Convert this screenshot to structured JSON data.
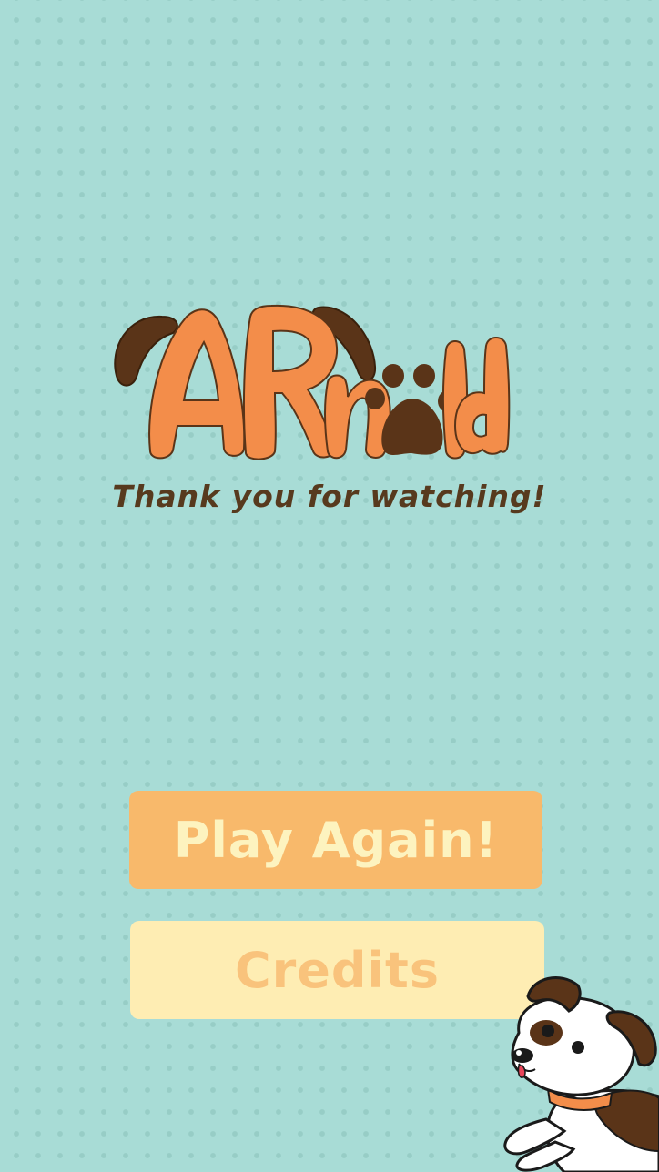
{
  "app": {
    "logo_text": "ARnold",
    "tagline": "Thank you for watching!"
  },
  "buttons": {
    "play_again": "Play Again!",
    "credits": "Credits"
  },
  "colors": {
    "background": "#a8dcd6",
    "logo_orange": "#f38d4a",
    "brown": "#573a1e",
    "play_button_bg": "#f8b96b",
    "play_button_text": "#fdf3bf",
    "credits_button_bg": "#feedb3",
    "credits_button_text": "#f9c37c"
  },
  "icons": {
    "mascot": "dog-mascot-icon",
    "paw": "paw-print-icon"
  }
}
